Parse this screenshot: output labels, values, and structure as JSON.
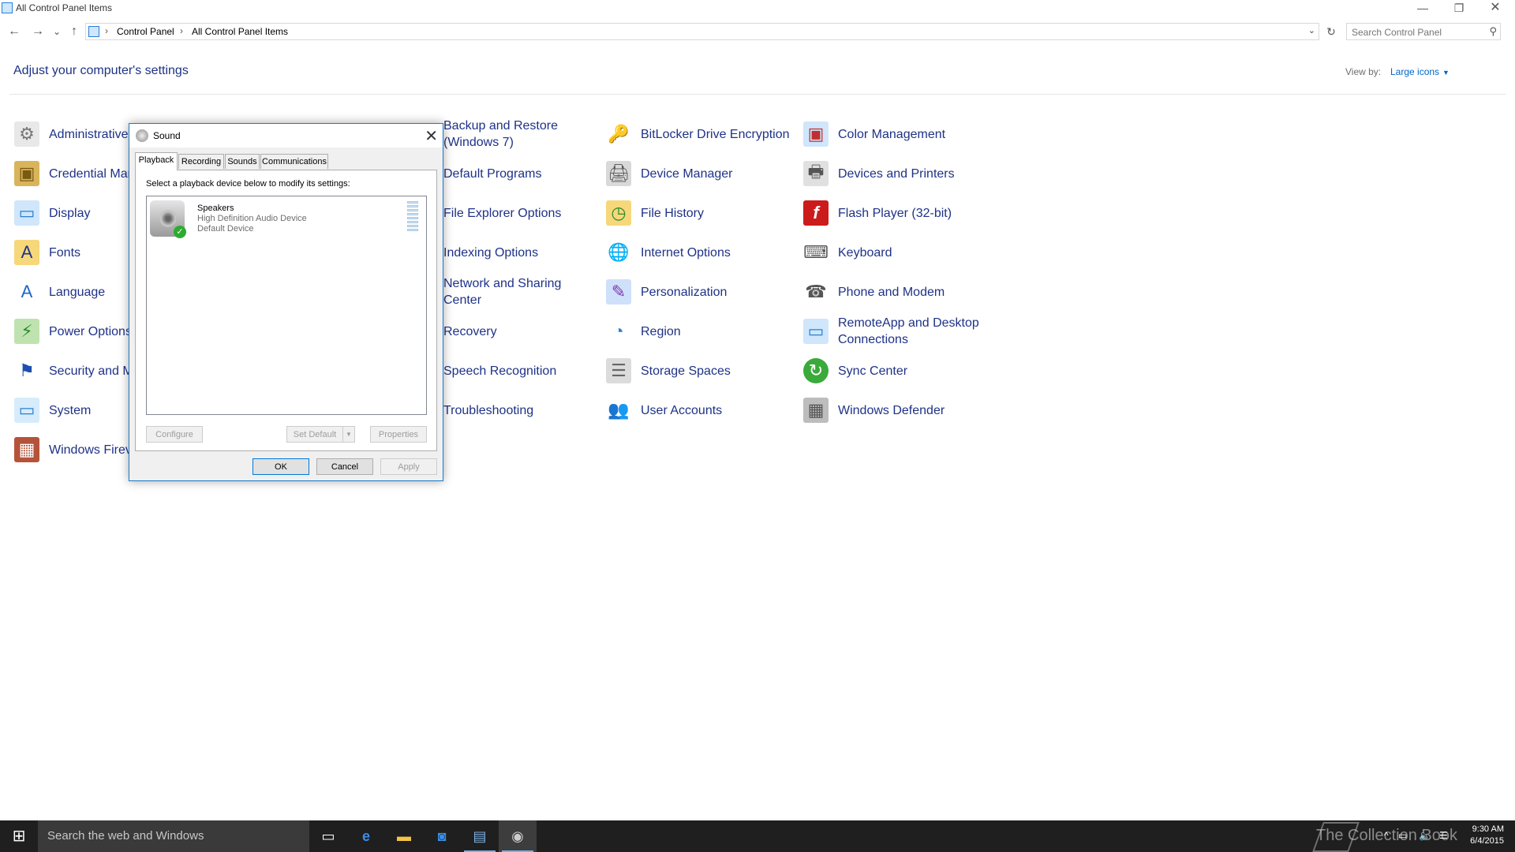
{
  "window": {
    "title": "All Control Panel Items",
    "minimize": "—",
    "maximize": "❐",
    "close": "✕"
  },
  "nav": {
    "back": "←",
    "forward": "→",
    "recent": "⌄",
    "up": "↑",
    "breadcrumb": [
      "Control Panel",
      "All Control Panel Items"
    ],
    "separator": "›",
    "refresh": "↻",
    "search_placeholder": "Search Control Panel"
  },
  "header": {
    "heading": "Adjust your computer's settings",
    "view_by_label": "View by:",
    "view_by_value": "Large icons"
  },
  "items": [
    {
      "label": "Administrative",
      "icon": "administrative-tools-icon"
    },
    {
      "label": "Credential Mar",
      "icon": "credential-manager-icon"
    },
    {
      "label": "Display",
      "icon": "display-icon"
    },
    {
      "label": "Fonts",
      "icon": "fonts-icon"
    },
    {
      "label": "Language",
      "icon": "language-icon"
    },
    {
      "label": "Power Options",
      "icon": "power-options-icon"
    },
    {
      "label": "Security and M",
      "icon": "security-maintenance-icon"
    },
    {
      "label": "System",
      "icon": "system-icon"
    },
    {
      "label": "Windows Firev",
      "icon": "windows-firewall-icon"
    },
    {
      "label": "Backup and Restore (Windows 7)",
      "icon": "backup-restore-icon"
    },
    {
      "label": "Default Programs",
      "icon": "default-programs-icon"
    },
    {
      "label": "File Explorer Options",
      "icon": "file-explorer-options-icon"
    },
    {
      "label": "Indexing Options",
      "icon": "indexing-options-icon"
    },
    {
      "label": "Network and Sharing Center",
      "icon": "network-sharing-icon"
    },
    {
      "label": "Recovery",
      "icon": "recovery-icon"
    },
    {
      "label": "Speech Recognition",
      "icon": "speech-recognition-icon"
    },
    {
      "label": "Troubleshooting",
      "icon": "troubleshooting-icon"
    },
    {
      "label": "BitLocker Drive Encryption",
      "icon": "bitlocker-icon"
    },
    {
      "label": "Device Manager",
      "icon": "device-manager-icon"
    },
    {
      "label": "File History",
      "icon": "file-history-icon"
    },
    {
      "label": "Internet Options",
      "icon": "internet-options-icon"
    },
    {
      "label": "Personalization",
      "icon": "personalization-icon"
    },
    {
      "label": "Region",
      "icon": "region-icon"
    },
    {
      "label": "Storage Spaces",
      "icon": "storage-spaces-icon"
    },
    {
      "label": "User Accounts",
      "icon": "user-accounts-icon"
    },
    {
      "label": "Color Management",
      "icon": "color-management-icon"
    },
    {
      "label": "Devices and Printers",
      "icon": "devices-printers-icon"
    },
    {
      "label": "Flash Player (32-bit)",
      "icon": "flash-player-icon"
    },
    {
      "label": "Keyboard",
      "icon": "keyboard-icon"
    },
    {
      "label": "Phone and Modem",
      "icon": "phone-modem-icon"
    },
    {
      "label": "RemoteApp and Desktop Connections",
      "icon": "remoteapp-icon"
    },
    {
      "label": "Sync Center",
      "icon": "sync-center-icon"
    },
    {
      "label": "Windows Defender",
      "icon": "windows-defender-icon"
    }
  ],
  "dialog": {
    "title": "Sound",
    "close": "✕",
    "tabs": [
      "Playback",
      "Recording",
      "Sounds",
      "Communications"
    ],
    "instruction": "Select a playback device below to modify its settings:",
    "device": {
      "name": "Speakers",
      "description": "High Definition Audio Device",
      "status": "Default Device"
    },
    "buttons": {
      "configure": "Configure",
      "set_default": "Set Default",
      "set_default_arrow": "▼",
      "properties": "Properties",
      "ok": "OK",
      "cancel": "Cancel",
      "apply": "Apply"
    }
  },
  "taskbar": {
    "start": "⊞",
    "search_text": "Search the web and Windows",
    "watermark": "The Collection Book",
    "tray_chevron": "^",
    "time": "9:30 AM",
    "date": "6/4/2015"
  },
  "colors": {
    "link": "#1e3287",
    "dialog_border": "#1979ca",
    "taskbar": "#1f1f1f"
  }
}
